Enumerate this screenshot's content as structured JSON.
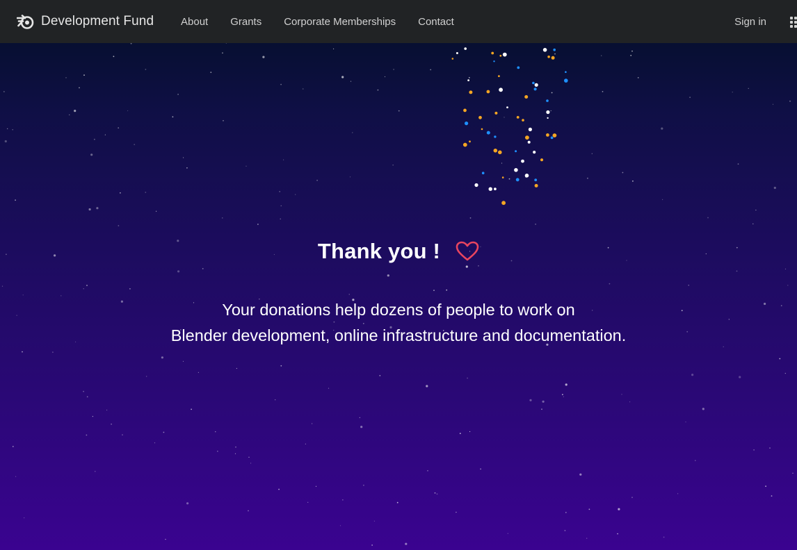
{
  "nav": {
    "brand": "Development Fund",
    "links": [
      "About",
      "Grants",
      "Corporate Memberships",
      "Contact"
    ],
    "sign_in": "Sign in",
    "brand_icon": "blender-logo-icon",
    "apps_icon": "apps-grid-icon"
  },
  "hero": {
    "title": "Thank you !",
    "heart_icon": "heart-icon",
    "heart_color": "#e8455f",
    "message_line1": "Your donations help dozens of people to work on",
    "message_line2": "Blender development, online infrastructure and documentation."
  },
  "colors": {
    "navbar": "#212325",
    "gradient_top": "#020f25",
    "gradient_bottom": "#3a0390",
    "confetti_gold": "#f5a623",
    "confetti_blue": "#1e90ff",
    "confetti_white": "#ffffff"
  }
}
